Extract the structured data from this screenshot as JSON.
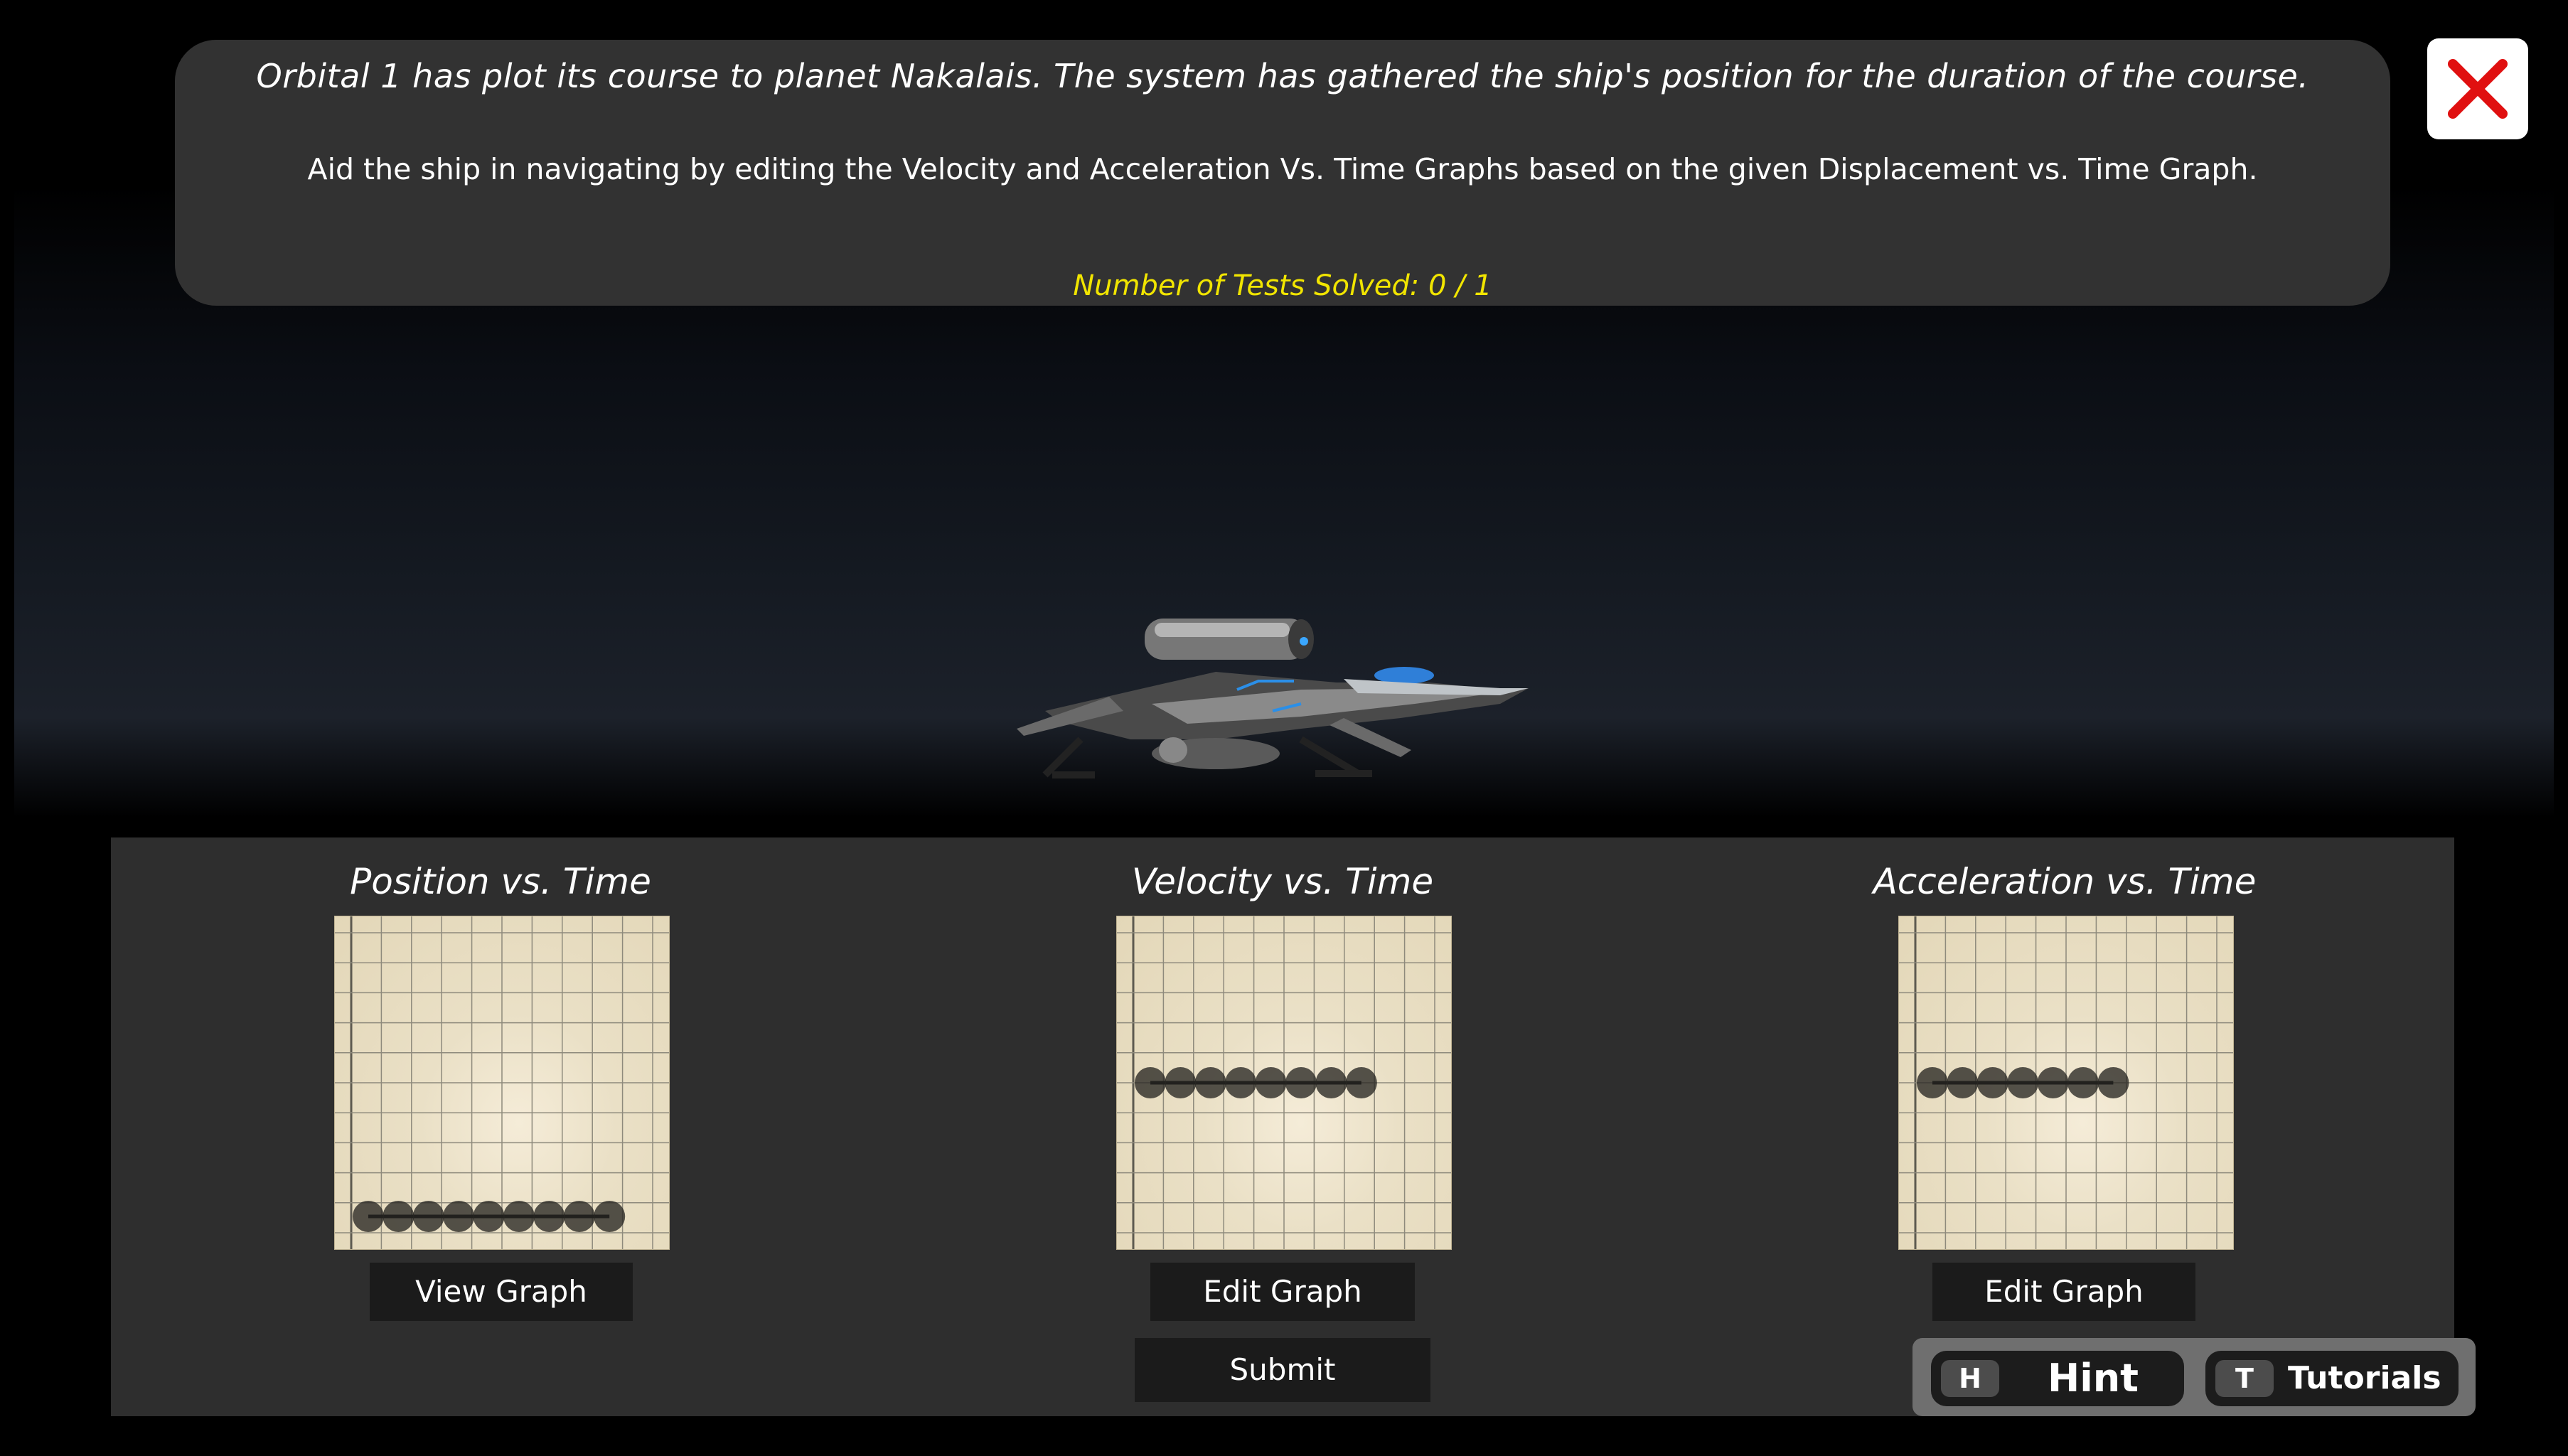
{
  "briefing": {
    "title": "Orbital 1 has plot its course to planet Nakalais. The system has gathered the ship's position for the duration of the course.",
    "instructions": "Aid the ship in navigating by editing the Velocity and Acceleration Vs. Time Graphs based on the given Displacement vs. Time Graph.",
    "tests_solved": "Number of Tests Solved: 0 / 1"
  },
  "close_button": {
    "icon": "close-icon",
    "color": "#e01010"
  },
  "graphs": [
    {
      "title": "Position vs. Time",
      "button_label": "View Graph",
      "points": [
        [
          0,
          0
        ],
        [
          1,
          0
        ],
        [
          2,
          0
        ],
        [
          3,
          0
        ],
        [
          4,
          0
        ],
        [
          5,
          0
        ],
        [
          6,
          0
        ],
        [
          7,
          0
        ],
        [
          8,
          0
        ]
      ]
    },
    {
      "title": "Velocity vs. Time",
      "button_label": "Edit Graph",
      "points": [
        [
          0,
          5
        ],
        [
          1,
          5
        ],
        [
          2,
          5
        ],
        [
          3,
          5
        ],
        [
          4,
          5
        ],
        [
          5,
          5
        ],
        [
          6,
          5
        ],
        [
          7,
          5
        ]
      ]
    },
    {
      "title": "Acceleration vs. Time",
      "button_label": "Edit Graph",
      "points": [
        [
          0,
          5
        ],
        [
          1,
          5
        ],
        [
          2,
          5
        ],
        [
          3,
          5
        ],
        [
          4,
          5
        ],
        [
          5,
          5
        ],
        [
          6,
          5
        ]
      ]
    }
  ],
  "grid": {
    "columns": 10,
    "rows": 10
  },
  "submit_label": "Submit",
  "hud": {
    "hint": {
      "key": "H",
      "label": "Hint"
    },
    "tutorials": {
      "key": "T",
      "label": "Tutorials"
    }
  },
  "colors": {
    "accent_yellow": "#f1e500",
    "panel": "#2e2e2e",
    "graph_paper": "#e8dec4"
  }
}
